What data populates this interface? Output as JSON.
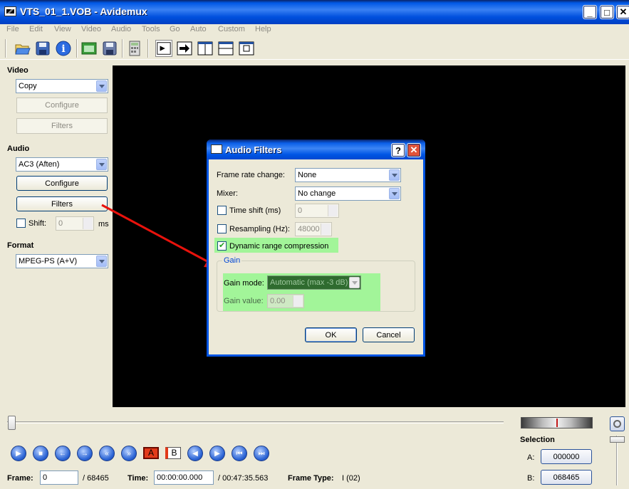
{
  "window": {
    "title": "VTS_01_1.VOB - Avidemux"
  },
  "window_controls": {
    "minimize": "_",
    "maximize": "□",
    "close": "✕"
  },
  "menu": [
    "File",
    "Edit",
    "View",
    "Video",
    "Audio",
    "Tools",
    "Go",
    "Auto",
    "Custom",
    "Help"
  ],
  "toolbar": {
    "icons": [
      "open-icon",
      "save-icon",
      "info-icon",
      "open-folder-icon",
      "save-video-icon",
      "calculator-icon",
      "view-input-icon",
      "view-output-icon",
      "side-by-side-icon",
      "top-bottom-icon",
      "preview-icon"
    ]
  },
  "left_panel": {
    "video": {
      "label": "Video",
      "codec": "Copy",
      "configure": "Configure",
      "filters": "Filters"
    },
    "audio": {
      "label": "Audio",
      "codec": "AC3 (Aften)",
      "configure": "Configure",
      "filters": "Filters",
      "shift_label": "Shift:",
      "shift_value": "0",
      "shift_unit": "ms"
    },
    "format": {
      "label": "Format",
      "value": "MPEG-PS (A+V)"
    }
  },
  "dialog": {
    "title": "Audio Filters",
    "help": "?",
    "close": "✕",
    "frame_rate_label": "Frame rate change:",
    "frame_rate_value": "None",
    "mixer_label": "Mixer:",
    "mixer_value": "No change",
    "time_shift_label": "Time shift (ms)",
    "time_shift_value": "0",
    "resampling_label": "Resampling (Hz):",
    "resampling_value": "48000",
    "drc_label": "Dynamic range compression",
    "drc_checked": true,
    "gain_group": "Gain",
    "gain_mode_label": "Gain mode:",
    "gain_mode_value": "Automatic (max -3 dB)",
    "gain_value_label": "Gain value:",
    "gain_value": "0.00",
    "ok": "OK",
    "cancel": "Cancel",
    "highlight_color": "#66ff66",
    "arrow_color": "#e8120c"
  },
  "playback": {
    "buttons": [
      "play-icon",
      "stop-icon",
      "previous-frame-icon",
      "next-frame-icon",
      "rewind-icon",
      "fast-forward-icon",
      "marker-a-icon",
      "marker-b-icon",
      "previous-keyframe-icon",
      "next-keyframe-icon",
      "first-frame-icon",
      "last-frame-icon"
    ],
    "marker_a": "A",
    "marker_b": "B"
  },
  "status": {
    "frame_label": "Frame:",
    "frame_value": "0",
    "frame_total": "/ 68465",
    "time_label": "Time:",
    "time_value": "00:00:00.000",
    "time_total": "/ 00:47:35.563",
    "frame_type_label": "Frame Type:",
    "frame_type_value": "I (02)"
  },
  "selection": {
    "label": "Selection",
    "a_label": "A:",
    "a_value": "000000",
    "b_label": "B:",
    "b_value": "068465"
  }
}
